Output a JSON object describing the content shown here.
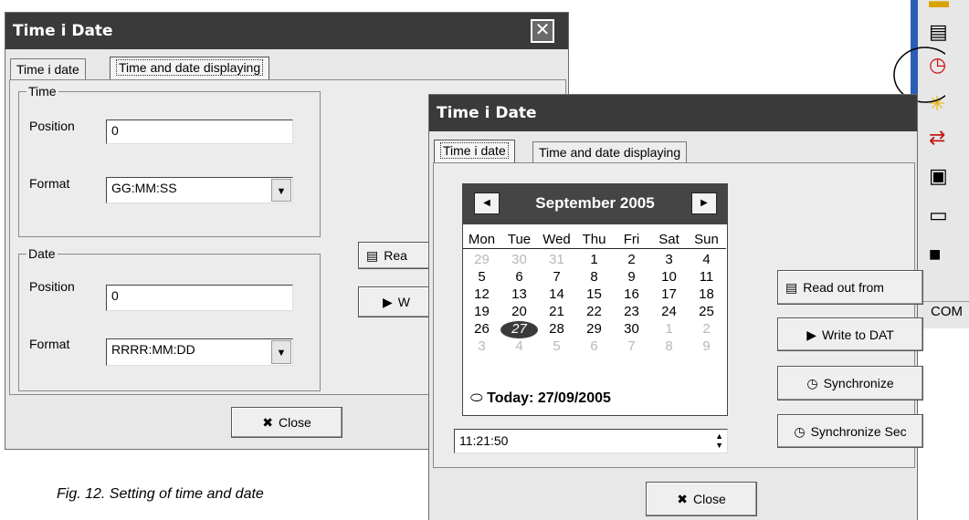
{
  "colors": {
    "titlebar": "#3a3a3a",
    "toolbar_frame": "#2c5eb8",
    "calendar_header": "#454545"
  },
  "back_window": {
    "title": "Time i Date",
    "tabs": [
      "Time i date",
      "Time and date displaying"
    ],
    "time_group": {
      "legend": "Time",
      "position_label": "Position",
      "position_value": "0",
      "format_label": "Format",
      "format_value": "GG:MM:SS"
    },
    "date_group": {
      "legend": "Date",
      "position_label": "Position",
      "position_value": "0",
      "format_label": "Format",
      "format_value": "RRRR:MM:DD"
    },
    "read_button": "Rea",
    "write_button": "W",
    "close_button": "Close"
  },
  "front_window": {
    "title": "Time i Date",
    "tabs": [
      "Time i date",
      "Time and date displaying"
    ],
    "calendar": {
      "month_label": "September 2005",
      "prev_icon": "left-arrow-icon",
      "next_icon": "right-arrow-icon",
      "weekdays": [
        "Mon",
        "Tue",
        "Wed",
        "Thu",
        "Fri",
        "Sat",
        "Sun"
      ],
      "weeks": [
        [
          "29",
          "30",
          "31",
          "1",
          "2",
          "3",
          "4"
        ],
        [
          "5",
          "6",
          "7",
          "8",
          "9",
          "10",
          "11"
        ],
        [
          "12",
          "13",
          "14",
          "15",
          "16",
          "17",
          "18"
        ],
        [
          "19",
          "20",
          "21",
          "22",
          "23",
          "24",
          "25"
        ],
        [
          "26",
          "27",
          "28",
          "29",
          "30",
          "1",
          "2"
        ],
        [
          "3",
          "4",
          "5",
          "6",
          "7",
          "8",
          "9"
        ]
      ],
      "selected_day": "27",
      "today_label": "Today: 27/09/2005"
    },
    "time_value": "11:21:50",
    "buttons": {
      "read_out": "Read out from",
      "write": "Write to DAT",
      "synchronize": "Synchronize",
      "synchronize_sec": "Synchronize Sec",
      "close": "Close"
    }
  },
  "toolbar": {
    "icons": [
      "folder-icon",
      "document-icon",
      "clock-icon",
      "sun-icon",
      "transfer-arrows-icon",
      "copy-icon",
      "open-folder-icon",
      "save-icon"
    ],
    "status": "COM"
  },
  "caption": "Fig. 12.   Setting of time and date"
}
